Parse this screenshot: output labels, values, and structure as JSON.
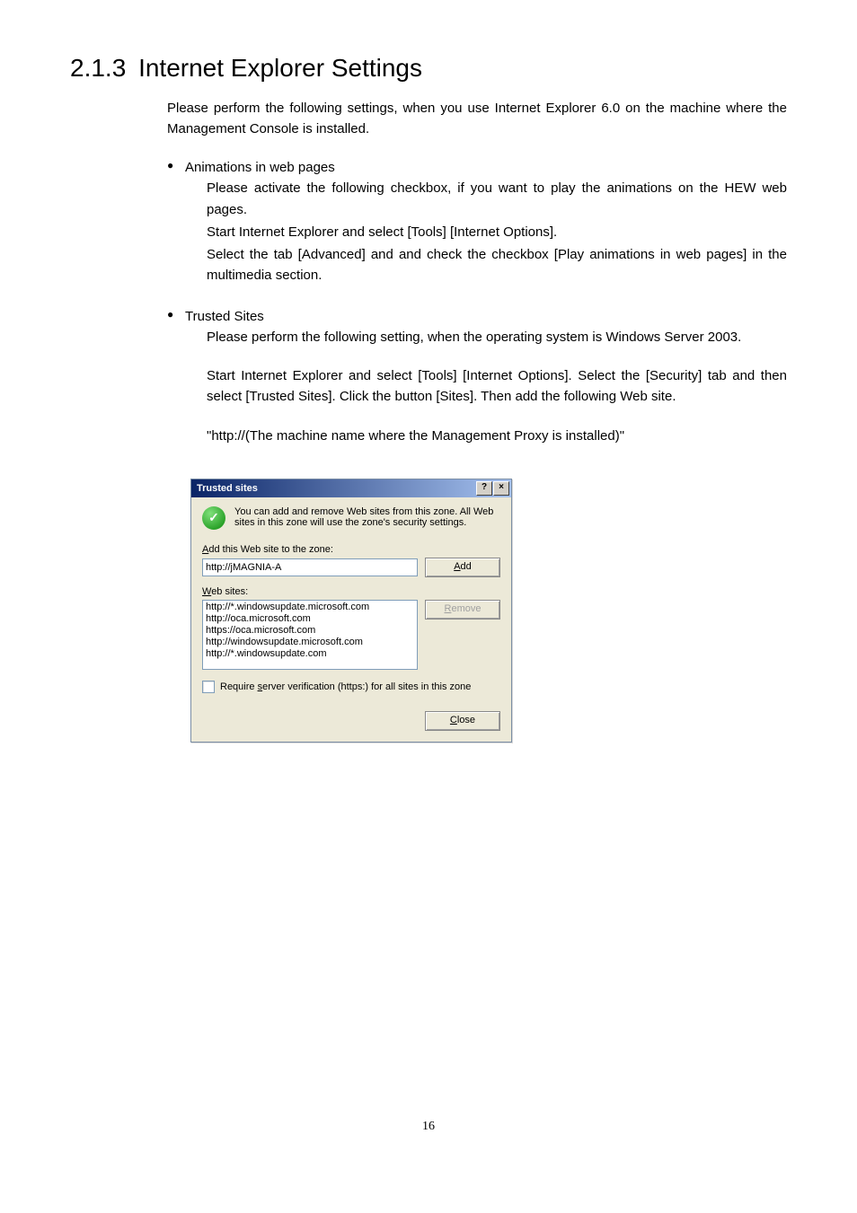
{
  "heading": {
    "number": "2.1.3",
    "title": "Internet Explorer Settings"
  },
  "intro": "Please perform the following settings, when you use Internet Explorer 6.0 on the machine where the Management Console is installed.",
  "bullet1": {
    "title": "Animations in web pages",
    "p1": "Please activate the following checkbox, if you want to play the animations on the HEW web pages.",
    "p2": "Start Internet Explorer and select [Tools] [Internet Options].",
    "p3": "Select the tab [Advanced] and and check the checkbox [Play animations in web pages] in the multimedia section."
  },
  "bullet2": {
    "title": "Trusted Sites",
    "p1": "Please perform the following setting, when the operating system is Windows Server 2003.",
    "p2": "Start Internet Explorer and select [Tools] [Internet Options]. Select the [Security] tab and then select [Trusted Sites]. Click the button [Sites]. Then add the following Web site.",
    "p3": "\"http://(The machine name where the Management Proxy is installed)\""
  },
  "dialog": {
    "title": "Trusted sites",
    "desc": "You can add and remove Web sites from this zone. All Web sites in this zone will use the zone's security settings.",
    "add_label_pre": "A",
    "add_label_rest": "dd this Web site to the zone:",
    "input_value": "http://jMAGNIA-A",
    "add_btn_pre": "A",
    "add_btn_rest": "dd",
    "websites_label_pre": "W",
    "websites_label_rest": "eb sites:",
    "sites": [
      "http://*.windowsupdate.microsoft.com",
      "http://oca.microsoft.com",
      "https://oca.microsoft.com",
      "http://windowsupdate.microsoft.com",
      "http://*.windowsupdate.com"
    ],
    "remove_btn_pre": "R",
    "remove_btn_rest": "emove",
    "require_label_pre": "Require ",
    "require_label_ul": "s",
    "require_label_rest": "erver verification (https:) for all sites in this zone",
    "close_btn_pre": "C",
    "close_btn_rest": "lose",
    "help_glyph": "?",
    "close_glyph": "×",
    "check_glyph": "✓"
  },
  "page_number": "16"
}
